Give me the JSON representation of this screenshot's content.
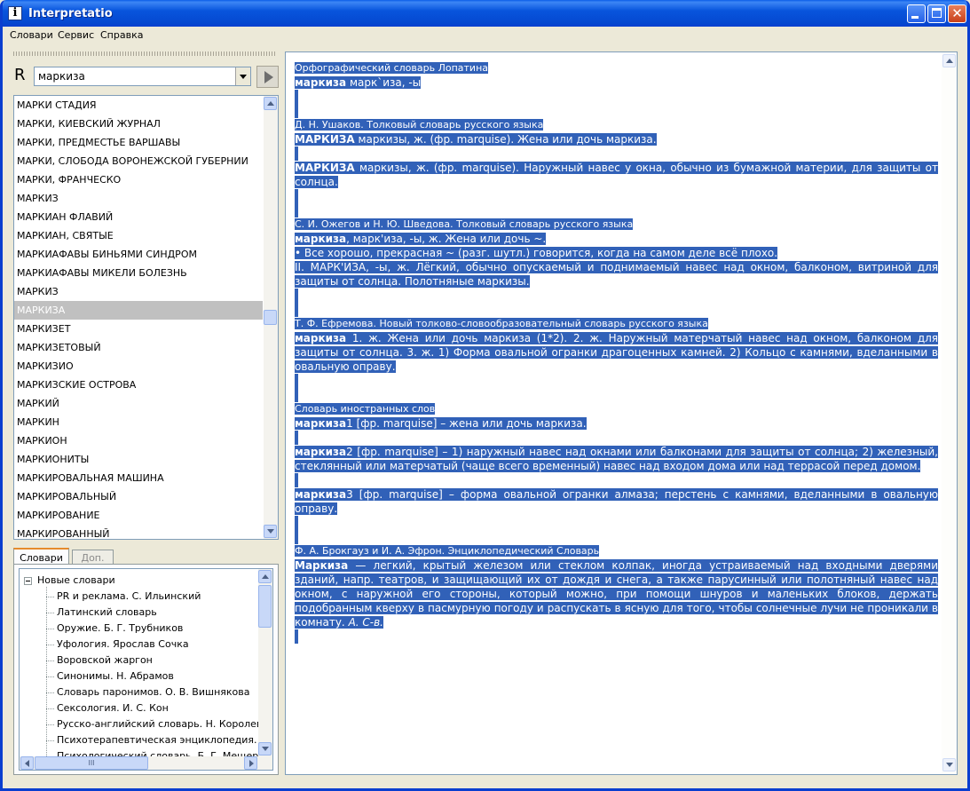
{
  "window": {
    "title": "Interpretatio",
    "icon": "info-icon",
    "title_bar_color": "#0a5ee8"
  },
  "menu": [
    {
      "label": "Словари"
    },
    {
      "label": "Сервис"
    },
    {
      "label": "Справка"
    }
  ],
  "search": {
    "lang_label": "R",
    "value": "маркиза"
  },
  "word_list": {
    "items": [
      "МАРКИ СТАДИЯ",
      "МАРКИ, КИЕВСКИЙ ЖУРНАЛ",
      "МАРКИ, ПРЕДМЕСТЬЕ ВАРШАВЫ",
      "МАРКИ, СЛОБОДА ВОРОНЕЖСКОЙ ГУБЕРНИИ",
      "МАРКИ, ФРАНЧЕСКО",
      "МАРКИЗ",
      "МАРКИАН ФЛАВИЙ",
      "МАРКИАН, СВЯТЫЕ",
      "МАРКИАФАВЫ БИНЬЯМИ СИНДРОМ",
      "МАРКИАФАВЫ МИКЕЛИ БОЛЕЗНЬ",
      "МАРКИЗ",
      "МАРКИЗА",
      "МАРКИЗЕТ",
      "МАРКИЗЕТОВЫЙ",
      "МАРКИЗИО",
      "МАРКИЗСКИЕ ОСТРОВА",
      "МАРКИЙ",
      "МАРКИН",
      "МАРКИОН",
      "МАРКИОНИТЫ",
      "МАРКИРОВАЛЬНАЯ МАШИНА",
      "МАРКИРОВАЛЬНЫЙ",
      "МАРКИРОВАНИЕ",
      "МАРКИРОВАННЫЙ"
    ],
    "selected_index": 11,
    "scroll_position": 0.5
  },
  "tabs": [
    {
      "label": "Словари",
      "active": true
    },
    {
      "label": "Доп.",
      "active": false
    }
  ],
  "dict_tree": {
    "root": "Новые словари",
    "children": [
      "PR и реклама. С. Ильинский",
      "Латинский словарь",
      "Оружие. Б. Г. Трубников",
      "Уфология. Ярослав Сочка",
      "Воровской жаргон",
      "Синонимы. Н. Абрамов",
      "Словарь паронимов. О. В. Вишнякова",
      "Сексология. И. С. Кон",
      "Русско-английский словарь. Н. Королев",
      "Психотерапевтическая энциклопедия.",
      "Психологический словарь. Б. Г. Мещеряк"
    ],
    "hscroll_grip": "III"
  },
  "article": {
    "highlight_color": "#3161b8",
    "blocks": [
      {
        "type": "source",
        "text": "Орфографический словарь Лопатина"
      },
      {
        "type": "entry",
        "headword": "маркиза",
        "text": " марк`иза, -ы"
      },
      {
        "type": "gap"
      },
      {
        "type": "gap"
      },
      {
        "type": "source",
        "text": "Д. Н. Ушаков. Толковый словарь русского языка"
      },
      {
        "type": "entry",
        "headword": "МАРКИЗА",
        "text": " маркизы, ж. (фр. marquise). Жена или дочь маркиза."
      },
      {
        "type": "gap"
      },
      {
        "type": "entry",
        "headword": "МАРКИЗА",
        "text": " маркизы, ж. (фр. marquise). Наружный навес у окна, обычно из бумажной материи, для защиты от солнца."
      },
      {
        "type": "gap"
      },
      {
        "type": "gap"
      },
      {
        "type": "source",
        "text": "С. И. Ожегов и Н. Ю. Шведова. Толковый словарь русского языка"
      },
      {
        "type": "entry",
        "headword": "маркиза",
        "text": ", марк'иза, -ы, ж. Жена или дочь ~."
      },
      {
        "type": "entry",
        "headword": "",
        "text": "• Все хорошо, прекрасная ~ (разг. шутл.) говорится, когда на самом деле всё плохо."
      },
      {
        "type": "entry",
        "headword": "",
        "text": "II. МАРК'ИЗА, -ы, ж. Лёгкий, обычно опускаемый и поднимаемый навес над окном, балконом, витриной для защиты от солнца. Полотняные маркизы."
      },
      {
        "type": "gap"
      },
      {
        "type": "gap"
      },
      {
        "type": "source",
        "text": "Т. Ф. Ефремова. Новый толково-словообразовательный словарь русского языка"
      },
      {
        "type": "entry",
        "headword": "маркиза",
        "text": " 1. ж. Жена или дочь маркиза (1*2). 2. ж. Наружный матерчатый навес над окном, балконом для защиты от солнца. 3. ж. 1) Форма овальной огранки драгоценных камней. 2) Кольцо с камнями, вделанными в овальную оправу."
      },
      {
        "type": "gap"
      },
      {
        "type": "gap"
      },
      {
        "type": "source",
        "text": "Словарь иностранных слов"
      },
      {
        "type": "entry",
        "headword": "маркиза",
        "text": "1 [фр. marquise] – жена или дочь маркиза."
      },
      {
        "type": "gap"
      },
      {
        "type": "entry",
        "headword": "маркиза",
        "text": "2 [фр. marquise] – 1) наружный навес над окнами или балконами для защиты от солнца; 2) железный, стеклянный или матерчатый (чаще всего временный) навес над входом дома или над террасой перед домом."
      },
      {
        "type": "gap"
      },
      {
        "type": "entry",
        "headword": "маркиза",
        "text": "3 [фр. marquise] – форма овальной огранки алмаза; перстень с камнями, вделанными в овальную оправу."
      },
      {
        "type": "gap"
      },
      {
        "type": "gap"
      },
      {
        "type": "source",
        "text": "Ф. А. Брокгауз и И. А. Эфрон. Энциклопедический Словарь"
      },
      {
        "type": "entry",
        "headword": "Маркиза",
        "text": " — легкий, крытый железом или стеклом колпак, иногда устраиваемый над входными дверями зданий, напр. театров, и защищающий их от дождя и снега, а также парусинный или полотняный навес над окном, с наружной его стороны, который можно, при помощи шнуров и маленьких блоков, держать подобранным кверху в пасмурную погоду и распускать в ясную для того, чтобы солнечные лучи не проникали в комнату.",
        "signature": " А. С-в."
      },
      {
        "type": "gap"
      }
    ]
  }
}
